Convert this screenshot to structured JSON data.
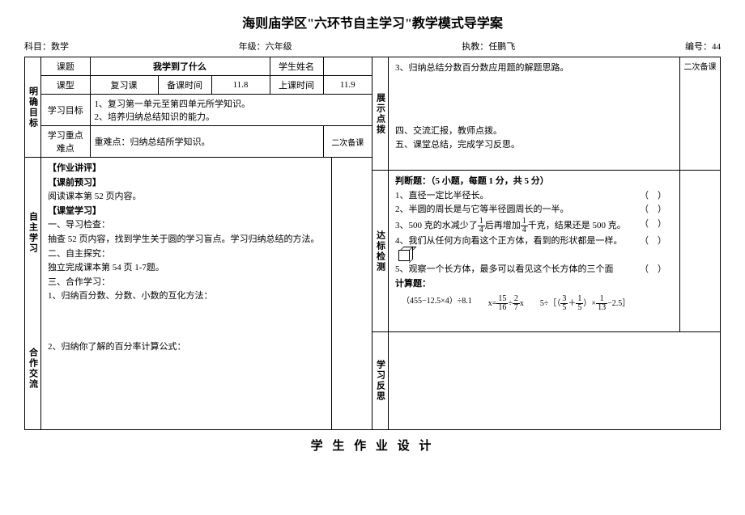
{
  "title": "海则庙学区\"六环节自主学习\"教学模式导学案",
  "header": {
    "subject_label": "科目：",
    "subject": "数学",
    "grade_label": "年级：",
    "grade": "六年级",
    "teacher_label": "执教：",
    "teacher": "任鹏飞",
    "number_label": "编号：",
    "number": "44"
  },
  "goals": {
    "label": "明确目标",
    "topic_label": "课题",
    "topic": "我学到了什么",
    "student_name_label": "学生姓名",
    "type_label": "课型",
    "type": "复习课",
    "prep_time_label": "备课时间",
    "prep_time": "11.8",
    "class_time_label": "上课时间",
    "class_time": "11.9",
    "objectives_label": "学习目标",
    "objectives_1": "1、复习第一单元至第四单元所学知识。",
    "objectives_2": "2、培养归纳总结知识的能力。",
    "keypoints_label": "学习重点难点",
    "keypoints": "重难点：归纳总结所学知识。",
    "second_prep_label": "二次备课"
  },
  "self_study": {
    "label": "自主学习",
    "hw_review": "【作业讲评】",
    "preview": "【课前预习】",
    "preview_content": "阅读课本第 52 页内容。",
    "class_study": "【课堂学习】",
    "step1": "一、导习检查：",
    "step1_content": "抽查 52 页内容，找到学生关于圆的学习盲点。学习归纳总结的方法。",
    "step2": "二、自主探究：",
    "step2_content": "独立完成课本第 54 页 1-7题。",
    "step3": "三、合作学习：",
    "step3_content": "1、归纳百分数、分数、小数的互化方法："
  },
  "cooperation": {
    "label": "合作交流",
    "content": "2、归纳你了解的百分率计算公式："
  },
  "presentation": {
    "label": "展示点拨",
    "item3": "3、归纳总结分数百分数应用题的解题思路。",
    "item4": "四、交流汇报，教师点拨。",
    "item5": "五、课堂总结，完成学习反思。",
    "second_prep_label": "二次备课"
  },
  "test": {
    "label": "达标检测",
    "judge_title": "判断题：（5 小题，每题 1 分，共 5 分）",
    "j1": "1、直径一定比半径长。",
    "j2": "2、半圆的周长是与它等半径圆周长的一半。",
    "j3_pre": "3、500 克的水减少了",
    "j3_mid": "后再增加",
    "j3_post": "千克，结果还是 500 克。",
    "j4": "4、我们从任何方向看这个正方体，看到的形状都是一样。",
    "j5": "5、观察一个长方体，最多可以看见这个长方体的三个面",
    "calc_title": "计算题：",
    "calc1": "（455−12.5×4）÷8.1",
    "calc2_pre": "x=",
    "calc2_mid": "÷",
    "calc2_post": "x",
    "calc3_pre": "5÷［（",
    "calc3_mid1": "＋",
    "calc3_mid2": "）×",
    "calc3_post": "−2.5］",
    "paren": "（　）",
    "frac_1_4_num": "1",
    "frac_1_4_den": "4",
    "frac_15_16_num": "15",
    "frac_15_16_den": "16",
    "frac_2_7_num": "2",
    "frac_2_7_den": "7",
    "frac_3_5_num": "3",
    "frac_3_5_den": "5",
    "frac_1_5_num": "1",
    "frac_1_5_den": "5",
    "frac_1_13_num": "1",
    "frac_1_13_den": "13"
  },
  "reflection": {
    "label": "学习反思"
  },
  "footer": "学 生 作 业 设 计"
}
